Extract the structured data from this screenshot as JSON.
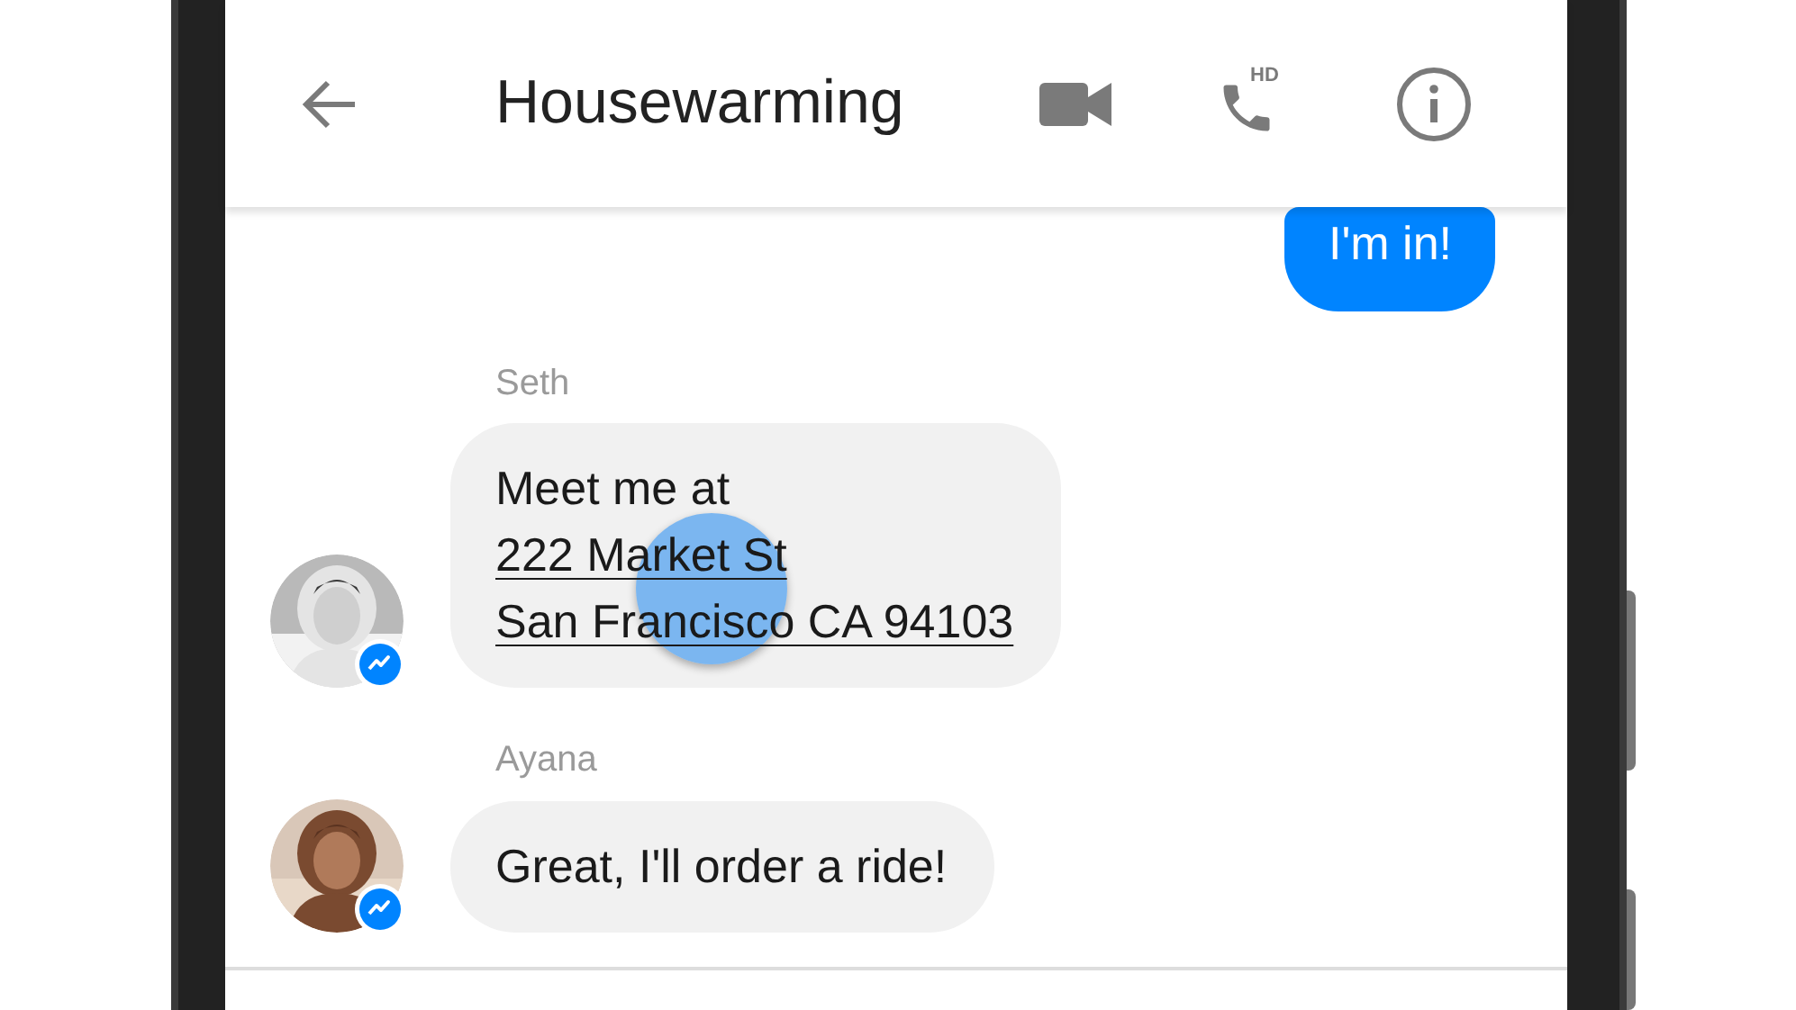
{
  "header": {
    "title": "Housewarming",
    "call_badge": "HD"
  },
  "messages": [
    {
      "kind": "outgoing",
      "lines": [
        {
          "text": "I'm in!",
          "link": false,
          "touched": false
        }
      ]
    },
    {
      "kind": "incoming",
      "sender": "Seth",
      "lines": [
        {
          "text": "Meet me at",
          "link": false,
          "touched": false
        },
        {
          "text": "222 Market St",
          "link": true,
          "touched": true
        },
        {
          "text": "San Francisco CA 94103",
          "link": true,
          "touched": false
        }
      ]
    },
    {
      "kind": "incoming",
      "sender": "Ayana",
      "lines": [
        {
          "text": "Great, I'll order a ride!",
          "link": false,
          "touched": false
        }
      ]
    }
  ]
}
